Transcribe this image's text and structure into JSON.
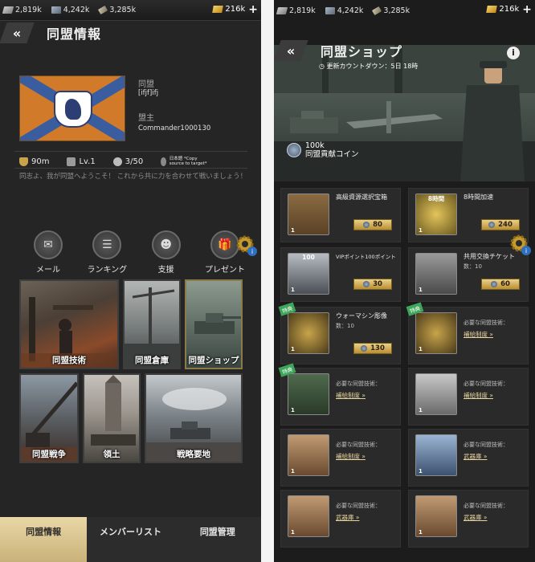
{
  "resources": {
    "oil": "2,819k",
    "steel": "4,242k",
    "ammo": "3,285k",
    "gold": "216k"
  },
  "left": {
    "title": "同盟情報",
    "alliance_label": "同盟",
    "alliance_name": "[ifjf]ifj",
    "leader_label": "盟主",
    "leader_name": "Commander1000130",
    "stat_power": "90m",
    "stat_level": "Lv.1",
    "stat_members": "3/50",
    "stat_language": "日本語 *Copy source to target*",
    "motto": "同志よ、我が同盟へようこそ！ これから共に力を合わせて戦いましょう！",
    "actions": [
      {
        "label": "メール",
        "icon": "mail-icon"
      },
      {
        "label": "ランキング",
        "icon": "ranking-icon"
      },
      {
        "label": "支援",
        "icon": "support-icon"
      },
      {
        "label": "プレゼント",
        "icon": "gift-icon"
      }
    ],
    "tiles": [
      "同盟技術",
      "同盟倉庫",
      "同盟ショップ",
      "同盟戦争",
      "領土",
      "戦略要地"
    ],
    "tabs": [
      "同盟情報",
      "メンバーリスト",
      "同盟管理"
    ]
  },
  "right": {
    "title": "同盟ショップ",
    "countdown": "更新カウントダウン：5日 18時",
    "coins_amount": "100k",
    "coins_label": "同盟貢献コイン",
    "items": [
      {
        "name": "高級資源選択宝箱",
        "qty": "1",
        "price": "80"
      },
      {
        "name": "8時間加速",
        "qty": "1",
        "price": "240",
        "thumb_label": "8時間"
      },
      {
        "name": "VIPポイント100ポイント",
        "qty": "1",
        "price": "30",
        "thumb_label": "100"
      },
      {
        "name": "共用交換チケット",
        "sub": "数：10",
        "qty": "1",
        "price": "60"
      },
      {
        "name": "ウォーマシン彫像",
        "sub": "数：10",
        "qty": "1",
        "price": "130",
        "tag": "特典"
      },
      {
        "req": "必要な同盟技術：",
        "link": "補給制度",
        "qty": "1",
        "tag": "特典"
      },
      {
        "req": "必要な同盟技術：",
        "link": "補給制度",
        "qty": "1",
        "tag": "特典"
      },
      {
        "req": "必要な同盟技術：",
        "link": "補給制度",
        "qty": "1"
      },
      {
        "req": "必要な同盟技術：",
        "link": "補給制度",
        "qty": "1"
      },
      {
        "req": "必要な同盟技術：",
        "link": "武器庫",
        "qty": "1"
      },
      {
        "req": "必要な同盟技術：",
        "link": "武器庫",
        "qty": "1"
      },
      {
        "req": "必要な同盟技術：",
        "link": "武器庫",
        "qty": "1"
      }
    ]
  }
}
